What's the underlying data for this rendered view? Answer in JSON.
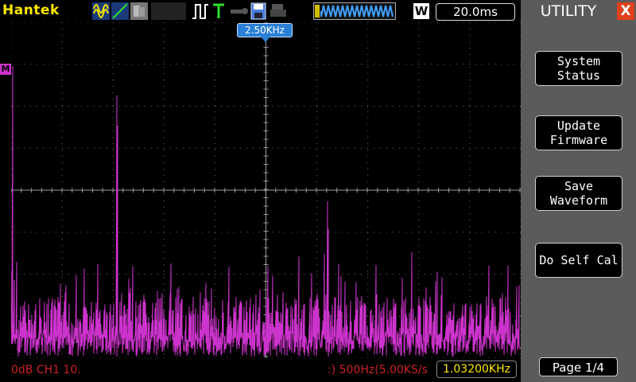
{
  "topbar": {
    "brand": "Hantek",
    "timebase": "20.0ms",
    "acq_mode_badge": "W",
    "icons": [
      "waveform-mode-icon",
      "line-mode-icon",
      "persist-icon",
      "trigger-edge-icon",
      "trigger-T-icon",
      "probe-icon",
      "save-icon",
      "print-icon",
      "memory-waveform-icon"
    ]
  },
  "plot": {
    "cursor_freq_label": "2.50KHz",
    "channel_marker": "M",
    "trace_color": "#cc33cc",
    "grid_color": "#6a6a6a"
  },
  "bottombar": {
    "left_text": "0dB  CH1  10.",
    "right_text": ":)  500Hz(5.00KS/s",
    "frequency": "1.03200KHz"
  },
  "panel": {
    "title": "UTILITY",
    "close_symbol": "X",
    "buttons": [
      {
        "label": "System\nStatus"
      },
      {
        "label": "Update\nFirmware"
      },
      {
        "label": "Save\nWaveform"
      },
      {
        "label": "Do Self Cal"
      }
    ],
    "page_label": "Page 1/4"
  },
  "colors": {
    "brand_yellow": "#ffe800",
    "panel_gray": "#5b5b5b",
    "close_red": "#e0401a",
    "status_red": "#cc2222",
    "cursor_blue": "#2a7fd6"
  }
}
